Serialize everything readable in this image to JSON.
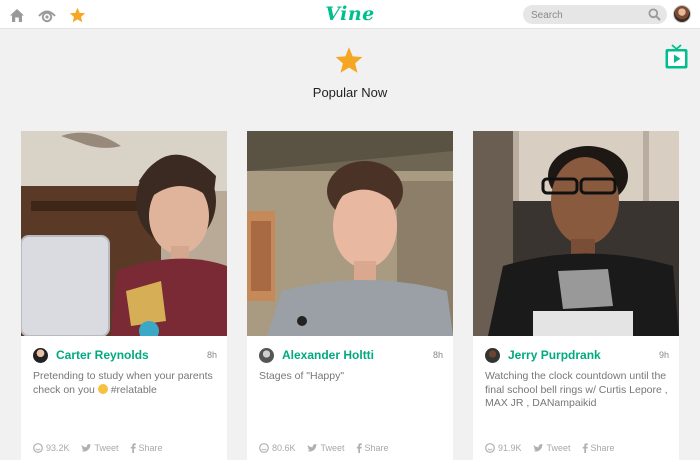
{
  "app": {
    "logo": "Vine"
  },
  "topbar": {
    "icons": [
      "home-icon",
      "eye-icon",
      "star-icon"
    ],
    "search": {
      "placeholder": "Search",
      "value": ""
    },
    "accent_color": "#00bf8f",
    "star_color": "#f5a623"
  },
  "page": {
    "title": "Popular Now"
  },
  "cards": [
    {
      "author": "Carter Reynolds",
      "time": "8h",
      "description": "Pretending to study when your parents check on you",
      "hashtag": "#relatable",
      "likes": "93.2K",
      "tweet_label": "Tweet",
      "share_label": "Share"
    },
    {
      "author": "Alexander Holtti",
      "time": "8h",
      "description": "Stages of \"Happy\"",
      "likes": "80.6K",
      "tweet_label": "Tweet",
      "share_label": "Share"
    },
    {
      "author": "Jerry Purpdrank",
      "time": "9h",
      "description": "Watching the clock countdown until the final school bell rings w/ Curtis Lepore , MAX JR , DANampaikid",
      "likes": "91.9K",
      "tweet_label": "Tweet",
      "share_label": "Share"
    }
  ]
}
